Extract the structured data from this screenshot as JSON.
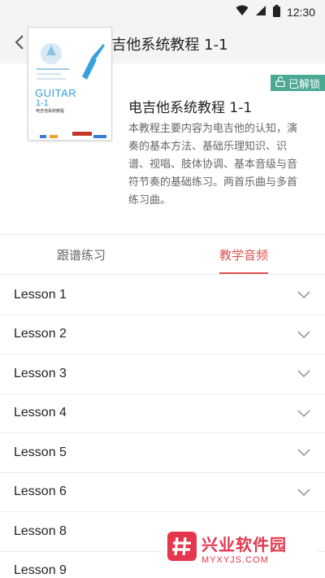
{
  "status_bar": {
    "time": "12:30",
    "icons": [
      "wifi-icon",
      "signal-icon",
      "battery-icon"
    ]
  },
  "header": {
    "title": "电吉他系统教程 1-1",
    "back_icon": "chevron-left-icon"
  },
  "book": {
    "badge": "已解锁",
    "badge_icon": "unlock-icon",
    "title": "电吉他系统教程 1-1",
    "description": "本教程主要内容为电吉他的认知，演奏的基本方法、基础乐理知识、识谱、视唱、肢体协调、基本音级与音符节奏的基础练习。两首乐曲与多首练习曲。",
    "cover": {
      "guitar_text": "GUITAR",
      "number_text": "1-1",
      "subtitle": "电吉他系统教程"
    }
  },
  "tabs": [
    {
      "label": "跟谱练习",
      "active": false
    },
    {
      "label": "教学音频",
      "active": true
    }
  ],
  "lessons": [
    {
      "label": "Lesson 1"
    },
    {
      "label": "Lesson 2"
    },
    {
      "label": "Lesson 3"
    },
    {
      "label": "Lesson 4"
    },
    {
      "label": "Lesson 5"
    },
    {
      "label": "Lesson 6"
    },
    {
      "label": "Lesson 8"
    },
    {
      "label": "Lesson 9"
    }
  ],
  "watermark": {
    "cn": "兴业软件园",
    "en": "MYXYJS.COM"
  },
  "colors": {
    "accent": "#d9534f",
    "badge": "#4aa893",
    "watermark": "#e4364d"
  }
}
